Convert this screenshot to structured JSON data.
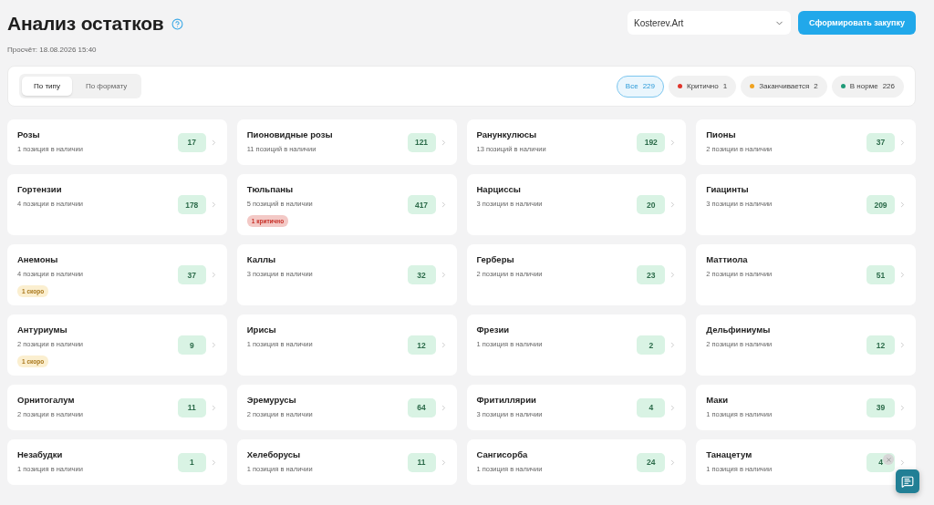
{
  "header": {
    "title": "Анализ остатков",
    "updated": "Просчёт: 18.08.2026 15:40"
  },
  "store_select": {
    "value": "Kosterev.Art"
  },
  "action_button": "Сформировать закупку",
  "view_tabs": [
    {
      "label": "По типу",
      "selected": true
    },
    {
      "label": "По формату",
      "selected": false
    }
  ],
  "filters": [
    {
      "label": "Все",
      "count": "229",
      "selected": true
    },
    {
      "label": "Критично",
      "count": "1",
      "selected": false,
      "color": "#e0352b"
    },
    {
      "label": "Заканчивается",
      "count": "2",
      "selected": false,
      "color": "#f0a21f"
    },
    {
      "label": "В норме",
      "count": "226",
      "selected": false,
      "color": "#1f9a78"
    }
  ],
  "categories": [
    {
      "name": "Розы",
      "positions": "1 позиция в наличии",
      "count": "17"
    },
    {
      "name": "Пионовидные розы",
      "positions": "11 позиций в наличии",
      "count": "121"
    },
    {
      "name": "Ранункулюсы",
      "positions": "13 позиций в наличии",
      "count": "192"
    },
    {
      "name": "Пионы",
      "positions": "2 позиции в наличии",
      "count": "37"
    },
    {
      "name": "Гортензии",
      "positions": "4 позиции в наличии",
      "count": "178"
    },
    {
      "name": "Тюльпаны",
      "positions": "5 позиций в наличии",
      "count": "417",
      "tag": {
        "kind": "critical",
        "label": "1 критично"
      }
    },
    {
      "name": "Нарциссы",
      "positions": "3 позиции в наличии",
      "count": "20"
    },
    {
      "name": "Гиацинты",
      "positions": "3 позиции в наличии",
      "count": "209"
    },
    {
      "name": "Анемоны",
      "positions": "4 позиции в наличии",
      "count": "37",
      "tag": {
        "kind": "soon",
        "label": "1 скоро"
      }
    },
    {
      "name": "Каллы",
      "positions": "3 позиции в наличии",
      "count": "32"
    },
    {
      "name": "Герберы",
      "positions": "2 позиции в наличии",
      "count": "23"
    },
    {
      "name": "Маттиола",
      "positions": "2 позиции в наличии",
      "count": "51"
    },
    {
      "name": "Антуриумы",
      "positions": "2 позиции в наличии",
      "count": "9",
      "tag": {
        "kind": "soon",
        "label": "1 скоро"
      }
    },
    {
      "name": "Ирисы",
      "positions": "1 позиция в наличии",
      "count": "12"
    },
    {
      "name": "Фрезии",
      "positions": "1 позиция в наличии",
      "count": "2"
    },
    {
      "name": "Дельфиниумы",
      "positions": "2 позиции в наличии",
      "count": "12"
    },
    {
      "name": "Орнитогалум",
      "positions": "2 позиции в наличии",
      "count": "11"
    },
    {
      "name": "Эремурусы",
      "positions": "2 позиции в наличии",
      "count": "64"
    },
    {
      "name": "Фритиллярии",
      "positions": "3 позиции в наличии",
      "count": "4"
    },
    {
      "name": "Маки",
      "positions": "1 позиция в наличии",
      "count": "39"
    },
    {
      "name": "Незабудки",
      "positions": "1 позиция в наличии",
      "count": "1"
    },
    {
      "name": "Хелеборусы",
      "positions": "1 позиция в наличии",
      "count": "11"
    },
    {
      "name": "Сангисорба",
      "positions": "1 позиция в наличии",
      "count": "24"
    },
    {
      "name": "Танацетум",
      "positions": "1 позиция в наличии",
      "count": "4"
    }
  ]
}
